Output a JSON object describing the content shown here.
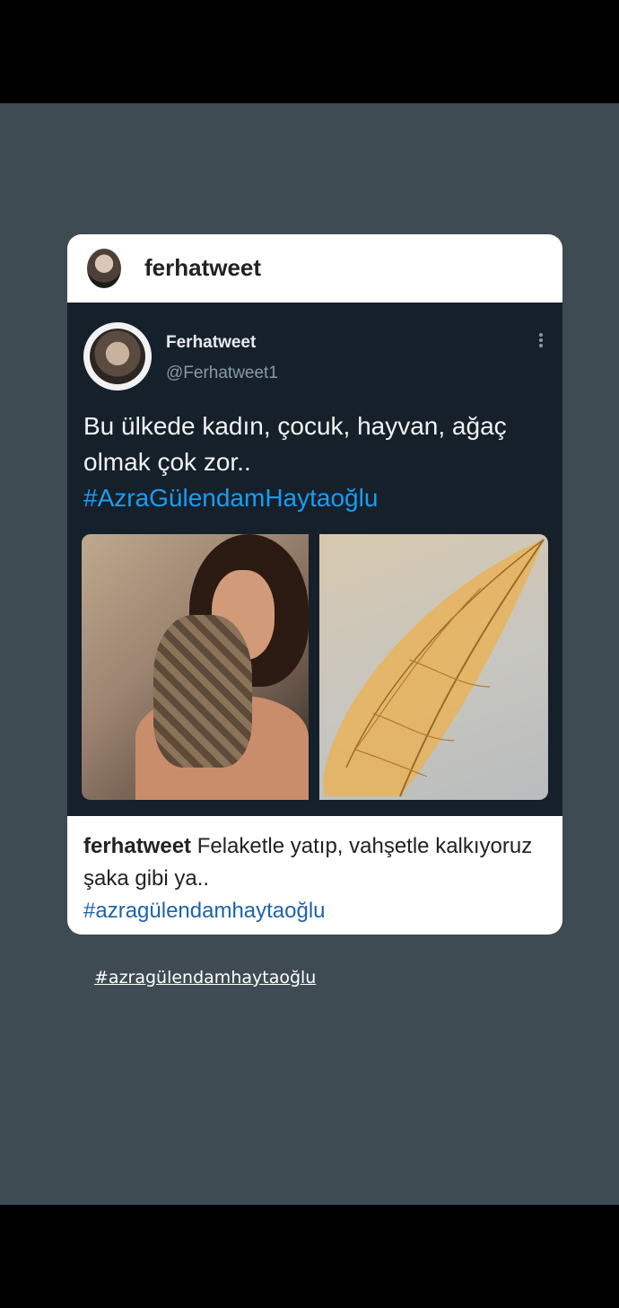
{
  "card": {
    "username": "ferhatweet"
  },
  "tweet": {
    "name": "Ferhatweet",
    "handle": "@Ferhatweet1",
    "text": "Bu ülkede kadın, çocuk, hayvan, ağaç olmak çok zor..",
    "hashtag": "#AzraGülendamHaytaoğlu"
  },
  "caption": {
    "user": "ferhatweet",
    "text": " Felaketle yatıp, vahşetle kalkıyoruz şaka gibi ya..",
    "hashtag": "#azragülendamhaytaoğlu"
  },
  "story": {
    "tag": "#azragülendamhaytaoğlu"
  }
}
